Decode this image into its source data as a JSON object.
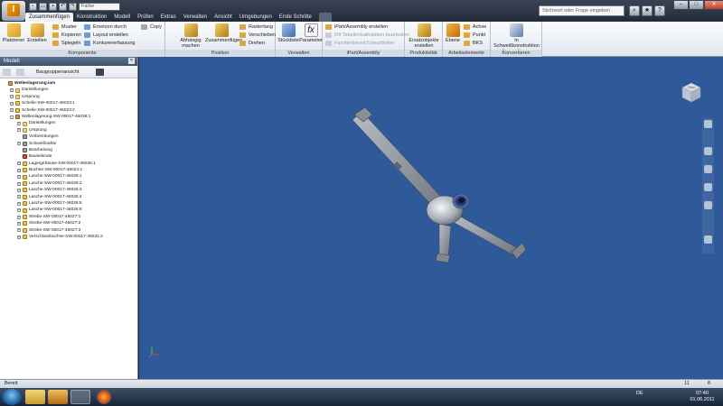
{
  "quick_access": {
    "buttons": [
      "new-icon",
      "open-icon",
      "save-icon",
      "undo-icon",
      "redo-icon"
    ],
    "color_combo": "Farbe"
  },
  "tabs": [
    {
      "label": "Zusammenfügen",
      "active": true
    },
    {
      "label": "Konstruktion"
    },
    {
      "label": "Modell"
    },
    {
      "label": "Prüfen"
    },
    {
      "label": "Extras"
    },
    {
      "label": "Verwalten"
    },
    {
      "label": "Ansicht"
    },
    {
      "label": "Umgebungen"
    },
    {
      "label": "Erste Schritte"
    }
  ],
  "search_placeholder": "Stichwort oder Frage eingeben",
  "window_controls": {
    "minimize": "–",
    "maximize": "□",
    "close": "✕"
  },
  "ribbon": {
    "komponente": {
      "title": "Komponente",
      "platzieren": "Platzieren",
      "erstellen": "Erstellen",
      "muster": "Muster",
      "kopieren": "Kopieren",
      "spiegeln": "Spiegeln",
      "ersetzen": "Ersetzen durch",
      "layout": "Layout erstellen",
      "kontur": "Konturenerfassung",
      "copy": "Copy"
    },
    "position": {
      "title": "Position",
      "abhaengig": "Abhängig machen",
      "zusammenfuegen": "Zusammenfügen",
      "rastfang": "Rasterfang",
      "verschieben": "Verschieben",
      "drehen": "Drehen"
    },
    "verwalten": {
      "title": "Verwalten",
      "stueckliste": "Stückliste",
      "parameter": "Parameter"
    },
    "ipart": {
      "title": "iPart/Assembly",
      "erstellen": "iPart/Assembly erstellen",
      "tabelle": "Mit Tabellenkalkulation bearbeiten",
      "familie": "Familienbereich bearbeiten"
    },
    "produktivitaet": {
      "title": "Produktivität",
      "ersatz": "Ersatzobjekte erstellen"
    },
    "arbeitselemente": {
      "title": "Arbeitselemente",
      "ebene": "Ebene",
      "achse": "Achse",
      "punkt": "Punkt",
      "bks": "BKS"
    },
    "konvertieren": {
      "title": "Konvertieren",
      "schweiss": "In Schweißkonstruktion konvertieren"
    }
  },
  "model_panel": {
    "title": "Modell",
    "view": "Baugruppenansicht",
    "tree": [
      {
        "level": 0,
        "label": "Wellenlagerung.iam",
        "icon": "asm",
        "bold": true
      },
      {
        "level": 1,
        "label": "Darstellungen",
        "icon": "folder",
        "exp": "+"
      },
      {
        "level": 1,
        "label": "Ursprung",
        "icon": "folder",
        "exp": "+"
      },
      {
        "level": 1,
        "label": "Schelle-SW-00017-46023:1",
        "icon": "part",
        "exp": "+"
      },
      {
        "level": 1,
        "label": "Schelle-SW-00017-46023:2",
        "icon": "part",
        "exp": "+"
      },
      {
        "level": 1,
        "label": "Wellenlagerung-SW-00017-46038:1",
        "icon": "asm",
        "exp": "-"
      },
      {
        "level": 2,
        "label": "Darstellungen",
        "icon": "folder",
        "exp": "+"
      },
      {
        "level": 2,
        "label": "Ursprung",
        "icon": "folder",
        "exp": "+"
      },
      {
        "level": 2,
        "label": "Vorbereitungen",
        "icon": "weld"
      },
      {
        "level": 2,
        "label": "Schweißnähte",
        "icon": "weld",
        "exp": "+"
      },
      {
        "level": 2,
        "label": "Bearbeitung",
        "icon": "weld"
      },
      {
        "level": 2,
        "label": "Bauteilende",
        "icon": "red"
      },
      {
        "level": 2,
        "label": "Lagergehäuse-SW-00017-46025:1",
        "icon": "part",
        "exp": "+"
      },
      {
        "level": 2,
        "label": "Buchse-SW-00017-46024:1",
        "icon": "part",
        "exp": "+"
      },
      {
        "level": 2,
        "label": "Lasche-SW-00017-46026:1",
        "icon": "part",
        "exp": "+"
      },
      {
        "level": 2,
        "label": "Lasche-SW-00017-46026:2",
        "icon": "part",
        "exp": "+"
      },
      {
        "level": 2,
        "label": "Lasche-SW-00017-46026:3",
        "icon": "part",
        "exp": "+"
      },
      {
        "level": 2,
        "label": "Lasche-SW-00017-46026:4",
        "icon": "part",
        "exp": "+"
      },
      {
        "level": 2,
        "label": "Lasche-SW-00017-46026:5",
        "icon": "part",
        "exp": "+"
      },
      {
        "level": 2,
        "label": "Lasche-SW-00017-46026:6",
        "icon": "part",
        "exp": "+"
      },
      {
        "level": 2,
        "label": "Strebe-SW-00017-46027:1",
        "icon": "part",
        "exp": "+"
      },
      {
        "level": 2,
        "label": "Strebe-SW-00017-46027:2",
        "icon": "part",
        "exp": "+"
      },
      {
        "level": 2,
        "label": "Strebe-SW-00017-46027:3",
        "icon": "part",
        "exp": "+"
      },
      {
        "level": 2,
        "label": "Verschlussbuchse-SW-00017-46031:2",
        "icon": "part",
        "exp": "+"
      }
    ]
  },
  "viewcube_label": "Oben",
  "status": {
    "left": "Bereit",
    "n1": "11",
    "n2": "8"
  },
  "taskbar": {
    "language": "DE",
    "time": "07:40",
    "date": "01.06.2011"
  },
  "colors": {
    "viewport_bg": "#2f5a9a",
    "ribbon_bg": "#eef1f5",
    "model_gray": "#8a8f96"
  }
}
